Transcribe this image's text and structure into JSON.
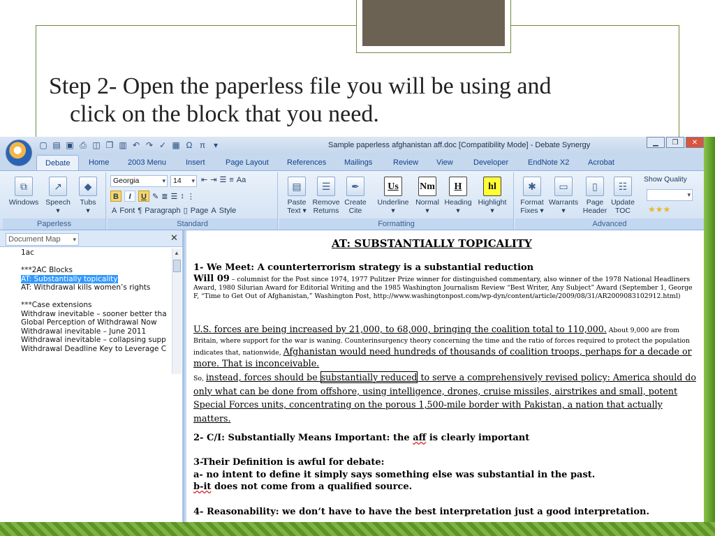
{
  "slide": {
    "title_line1": "Step 2- Open the paperless file you will be using and",
    "title_line2": "click on the block that you need."
  },
  "window": {
    "title": "Sample paperless afghanistan aff.doc [Compatibility Mode] - Debate Synergy"
  },
  "tabs": [
    "Debate",
    "Home",
    "2003 Menu",
    "Insert",
    "Page Layout",
    "References",
    "Mailings",
    "Review",
    "View",
    "Developer",
    "EndNote X2",
    "Acrobat"
  ],
  "ribbon": {
    "paperless": {
      "label": "Paperless",
      "buttons": [
        "Windows",
        "Speech",
        "Tubs"
      ]
    },
    "standard": {
      "label": "Standard",
      "font_name": "Georgia",
      "font_size": "14",
      "bold": "B",
      "italic": "I",
      "underline": "U",
      "font_label": "Font",
      "paragraph_label": "Paragraph",
      "page_label": "Page",
      "style_label": "Style"
    },
    "formatting": {
      "label": "Formatting",
      "buttons": [
        {
          "line1": "Paste",
          "line2": "Text ▾"
        },
        {
          "line1": "Remove",
          "line2": "Returns"
        },
        {
          "line1": "Create",
          "line2": "Cite"
        },
        {
          "line1": "Underline",
          "line2": "▾",
          "icon": "Us"
        },
        {
          "line1": "Normal",
          "line2": "▾",
          "icon": "Nm"
        },
        {
          "line1": "Heading",
          "line2": "▾",
          "icon": "H"
        },
        {
          "line1": "Highlight",
          "line2": "▾",
          "icon": "hl"
        }
      ]
    },
    "advanced": {
      "label": "Advanced",
      "buttons": [
        {
          "line1": "Format",
          "line2": "Fixes ▾"
        },
        {
          "line1": "Warrants",
          "line2": "▾"
        },
        {
          "line1": "Page",
          "line2": "Header"
        },
        {
          "line1": "Update",
          "line2": "TOC"
        }
      ],
      "show_quality": "Show Quality"
    }
  },
  "document_map": {
    "label": "Document Map",
    "items": [
      "1ac",
      "",
      "***2AC Blocks",
      "AT: Substantially topicality",
      "AT: Withdrawal kills women’s rights",
      "",
      "***Case extensions",
      "Withdraw inevitable – sooner better tha",
      "Global Perception of Withdrawal Now",
      "Withdrawal inevitable – June 2011",
      "Withdrawal inevitable – collapsing supp",
      "Withdrawal Deadline Key to Leverage C"
    ],
    "selected_index": 3
  },
  "document": {
    "heading": "AT: SUBSTANTIALLY TOPICALITY",
    "point1": "1- We Meet: A counterterrorism strategy is a substantial reduction",
    "cite_name": "Will 09",
    "cite_text": " – columnist for the Post since 1974, 1977 Pulitzer Prize winner for distinguished commentary, also winner of the 1978 National Headliners Award, 1980 Silurian Award for Editorial Writing and the 1985 Washington Journalism Review “Best Writer, Any Subject” Award (September 1, George F, “Time to Get Out of Afghanistan,” Washington Post, http://www.washingtonpost.com/wp-dyn/content/article/2009/08/31/AR2009083102912.html)",
    "card_a": "U.S. forces are being increased by 21,000, to 68,000, bringing the coalition total to 110,000.",
    "card_b": " About 9,000 are from Britain, where support for the war is waning. Counterinsurgency theory concerning the time and the ratio of forces required to protect the population indicates that, nationwide, ",
    "card_c": "Afghanistan would need hundreds of thousands of coalition troops, perhaps for a decade or more. That is inconceivable.",
    "card_d": "So, ",
    "card_e": "instead, forces should be ",
    "card_f": "substantially reduced",
    "card_g": " to serve a comprehensively revised policy: America should do only what can be done from offshore, using intelligence, drones, cruise missiles, airstrikes and small, potent Special Forces units, concentrating on the porous 1,500-mile border with Pakistan, a nation that actually matters.",
    "point2_a": "2- C/I: Substantially Means Important: the ",
    "point2_b": "aff",
    "point2_c": " is clearly important",
    "point3": "3-Their Definition is awful for debate:",
    "point3a": "a- no intent to define it simply says something else was substantial in the past.",
    "point3b_a": "b-it",
    "point3b_b": " does not come from a qualified source.",
    "point4": "4- Reasonability: we don’t have to have the best interpretation just a good interpretation."
  }
}
